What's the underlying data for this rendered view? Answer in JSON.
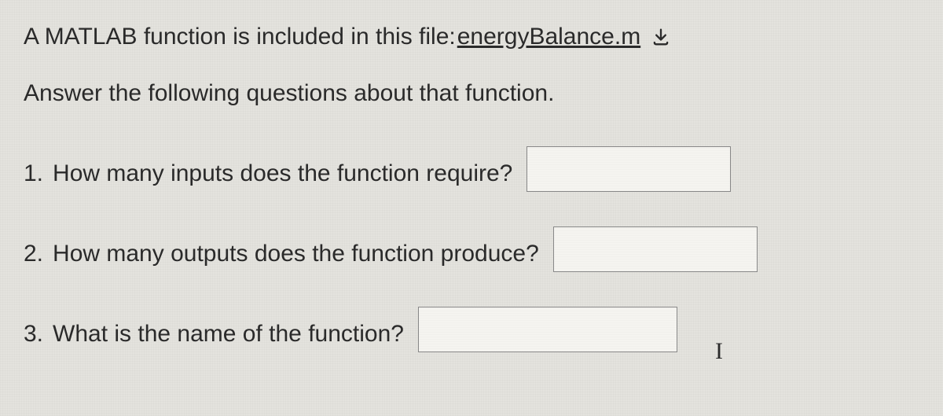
{
  "intro": {
    "prefix": "A MATLAB function is included in this file:",
    "filename": "energyBalance.m"
  },
  "instruction": "Answer the following questions about that function.",
  "questions": {
    "q1": {
      "number": "1.",
      "text": "How many inputs does the function require?",
      "value": ""
    },
    "q2": {
      "number": "2.",
      "text": "How many outputs does the function produce?",
      "value": ""
    },
    "q3": {
      "number": "3.",
      "text": "What is the name of the function?",
      "value": ""
    }
  },
  "caret": "I"
}
